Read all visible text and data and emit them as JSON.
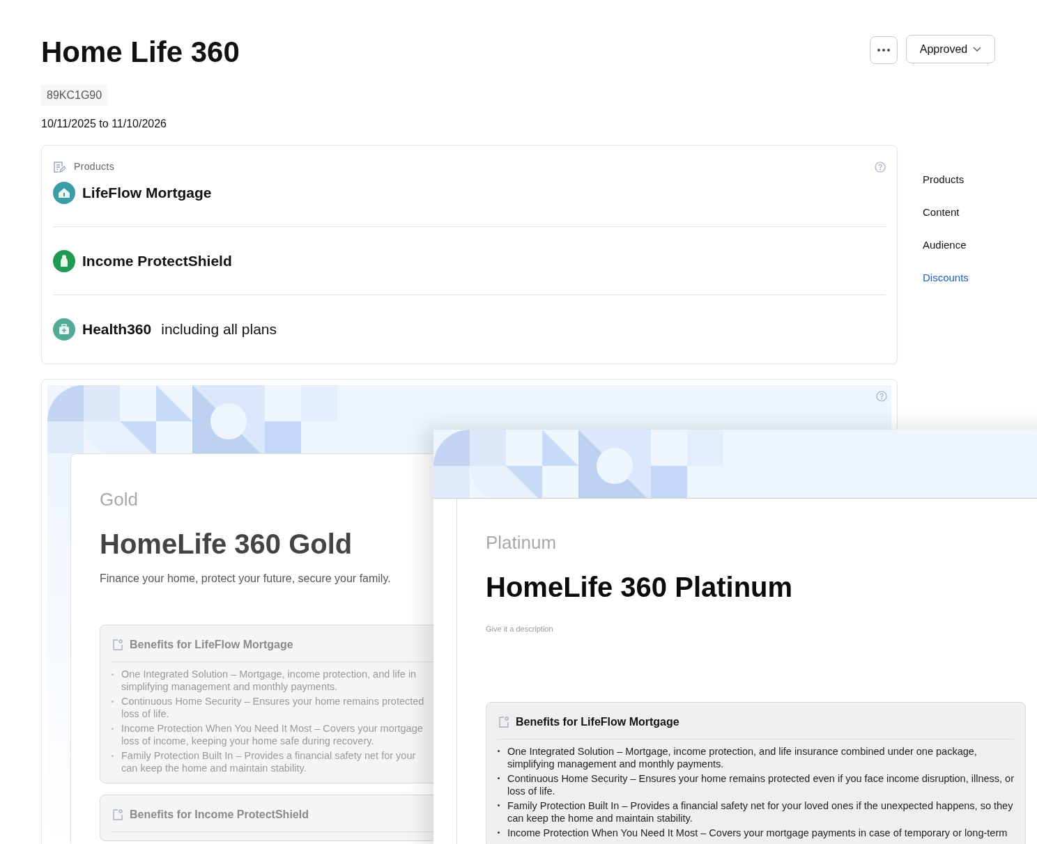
{
  "header": {
    "title": "Home Life 360",
    "code": "89KC1G90",
    "dates": "10/11/2025 to 11/10/2026",
    "status": "Approved"
  },
  "products": {
    "title": "Products",
    "items": [
      {
        "name": "LifeFlow Mortgage",
        "kind": "house"
      },
      {
        "name": "Income ProtectShield",
        "kind": "person"
      },
      {
        "name": "Health360",
        "note": "including all plans",
        "kind": "kit"
      }
    ]
  },
  "nav": [
    {
      "label": "Products",
      "selected": false
    },
    {
      "label": "Content",
      "selected": false
    },
    {
      "label": "Audience",
      "selected": false
    },
    {
      "label": "Discounts",
      "selected": true
    }
  ],
  "tiers": [
    {
      "tier": "Gold",
      "title": "HomeLife 360 Gold",
      "description": "Finance your home, protect your future, secure your family.",
      "benefits": [
        {
          "heading": "Benefits for LifeFlow Mortgage",
          "items": [
            {
              "lines": [
                "One Integrated Solution – Mortgage, income protection, and life in",
                "simplifying management and monthly payments."
              ]
            },
            {
              "lines": [
                "Continuous Home Security – Ensures your home remains protected",
                "loss of life."
              ]
            },
            {
              "lines": [
                "Income Protection When You Need It Most – Covers your mortgage",
                "loss of income, keeping your home safe during recovery."
              ]
            },
            {
              "lines": [
                "Family Protection Built In – Provides a financial safety net for your",
                "can keep the home and maintain stability."
              ]
            }
          ]
        },
        {
          "heading": "Benefits for Income ProtectShield"
        }
      ]
    },
    {
      "tier": "Platinum",
      "title": "HomeLife 360 Platinum",
      "placeholder": "Give it a description",
      "benefits": [
        {
          "heading": "Benefits for LifeFlow Mortgage",
          "items": [
            {
              "lines": [
                "One Integrated Solution – Mortgage, income protection, and life insurance combined under one package,",
                "simplifying management and monthly payments."
              ]
            },
            {
              "lines": [
                "Continuous Home Security – Ensures your home remains protected even if you face income disruption, illness, or",
                "loss of life."
              ]
            },
            {
              "lines": [
                "Family Protection Built In – Provides a financial safety net for your loved ones if the unexpected happens, so they",
                "can keep the home and maintain stability."
              ]
            },
            {
              "lines": [
                "Income Protection When You Need It Most – Covers your mortgage payments in case of temporary or long-term"
              ]
            }
          ]
        }
      ]
    }
  ]
}
